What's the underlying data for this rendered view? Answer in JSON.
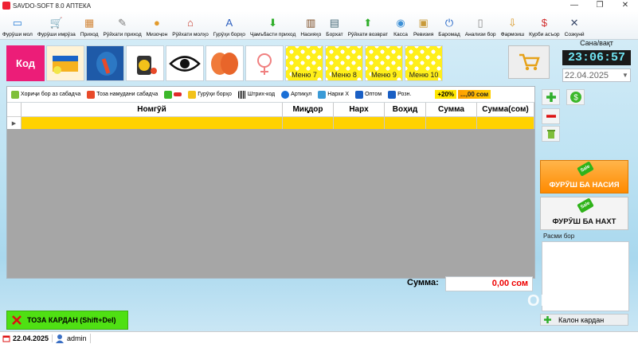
{
  "window": {
    "title": "SAVDO-SOFT 8.0 АПТЕКА"
  },
  "toolbar": [
    {
      "label": "Фурӯши мол",
      "icon": "monitor-icon",
      "color": "#2b7fd6"
    },
    {
      "label": "Фурӯши имрӯза",
      "icon": "cart-icon",
      "color": "#f09a1a"
    },
    {
      "label": "Приход",
      "icon": "boxes-icon",
      "color": "#d3873a"
    },
    {
      "label": "Рӯйхати приход",
      "icon": "pencil-icon",
      "color": "#7a7a7a"
    },
    {
      "label": "Мизоҷон",
      "icon": "user-icon",
      "color": "#e39b2c"
    },
    {
      "label": "Рӯйхати молҳо",
      "icon": "house-icon",
      "color": "#c63b2d"
    },
    {
      "label": "Гурӯҳи борҳо",
      "icon": "abc-icon",
      "color": "#2c5fbf"
    },
    {
      "label": "Ҷамъбасти приход",
      "icon": "down-arrow-icon",
      "color": "#2fae2a"
    },
    {
      "label": "Насияҳо",
      "icon": "book-icon",
      "color": "#7a4a22"
    },
    {
      "label": "Борхат",
      "icon": "table-icon",
      "color": "#4a6c7a"
    },
    {
      "label": "Рӯйхати возврат",
      "icon": "up-arrow-icon",
      "color": "#2fae2a"
    },
    {
      "label": "Касса",
      "icon": "coins-icon",
      "color": "#3b8fd6"
    },
    {
      "label": "Ревизия",
      "icon": "clipboard-icon",
      "color": "#c89a3a"
    },
    {
      "label": "Баромад",
      "icon": "power-icon",
      "color": "#1a5fc4"
    },
    {
      "label": "Анализи бор",
      "icon": "cabinet-icon",
      "color": "#8a8a8a"
    },
    {
      "label": "Фармоиш",
      "icon": "download-box-icon",
      "color": "#d99a2a"
    },
    {
      "label": "Курби асъор",
      "icon": "dollar-icon",
      "color": "#d12a2a"
    },
    {
      "label": "Созкунӣ",
      "icon": "tools-icon",
      "color": "#3a4a6a"
    }
  ],
  "tiles": {
    "kod_label": "Код",
    "menus": [
      "Меню 7",
      "Меню 8",
      "Меню 9",
      "Меню 10"
    ]
  },
  "date_panel": {
    "label": "Сана/вақт",
    "time": "23:06:57",
    "date": "22.04.2025"
  },
  "grid_toolbar": {
    "remove_label": "Хориҷи бор аз сабадча",
    "clear_label": "Тоза намудани сабадча",
    "groups_label": "Гурӯҳи борҳо",
    "barcode_label": "Штрих-код",
    "article_label": "Артикул",
    "price_x_label": "Нархи Х",
    "wholesale_label": "Оптом",
    "retail_label": "Розн.",
    "percent": "+20%",
    "sum_badge": "...,00 сом"
  },
  "grid": {
    "columns": [
      "Номгӯй",
      "Миқдор",
      "Нарх",
      "Воҳид",
      "Сумма",
      "Сумма(сом)"
    ],
    "rows": [
      [
        "",
        "",
        "",
        "",
        "",
        ""
      ]
    ]
  },
  "summary": {
    "label": "Сумма:",
    "value": "0,00 сом"
  },
  "buttons": {
    "clear_cart": "ТОЗА КАРДАН (Shift+Del)",
    "sale_credit": "ФУРӮШ БА НАСИЯ",
    "sale_cash": "ФУРӮШ БА НАХТ",
    "sale_tag": "Sale",
    "image_label": "Расми бор",
    "kalon": "Калон кардан"
  },
  "watermark": "OLA.TJ",
  "statusbar": {
    "date": "22.04.2025",
    "user": "admin"
  }
}
